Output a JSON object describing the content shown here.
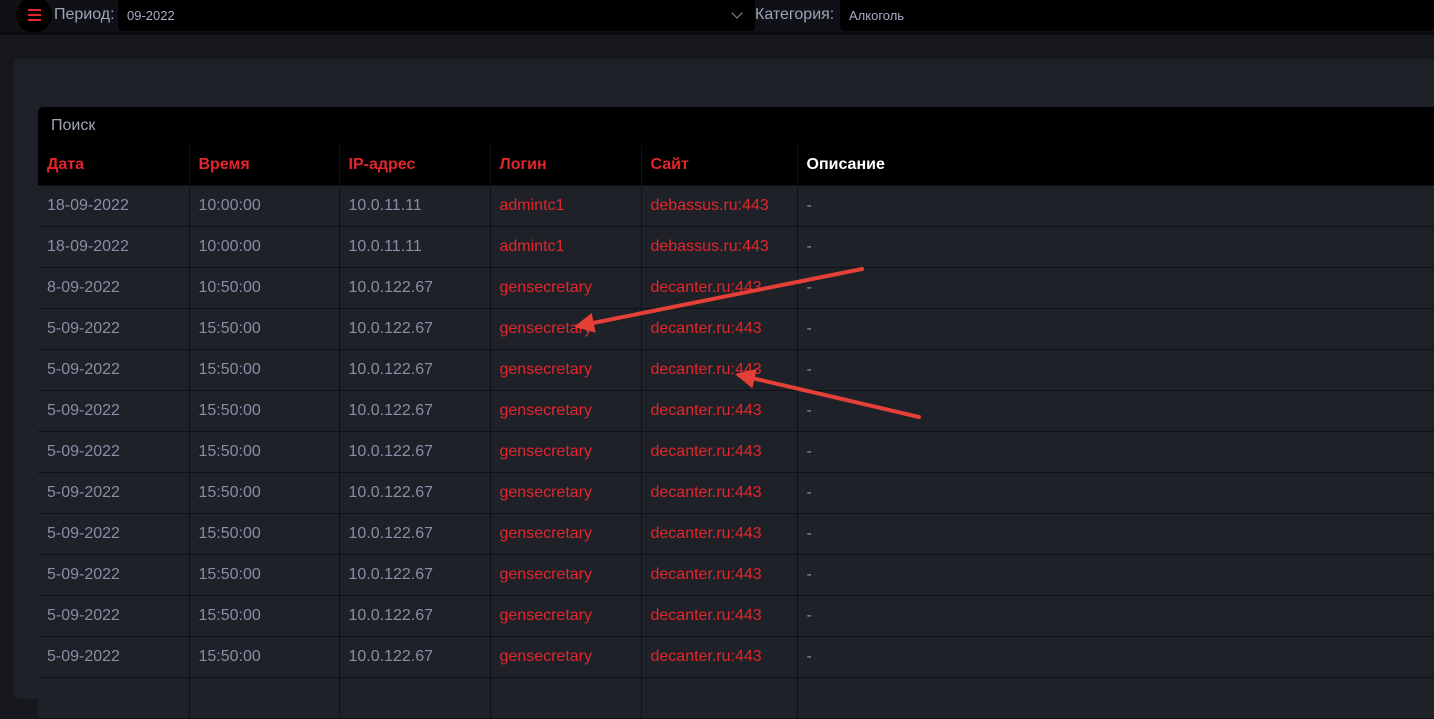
{
  "topbar": {
    "period_label": "Период:",
    "period_value": "09-2022",
    "category_label": "Категория:",
    "category_value": "Алкоголь"
  },
  "search": {
    "placeholder": "Поиск"
  },
  "table": {
    "headers": [
      "Дата",
      "Время",
      "IP-адрес",
      "Логин",
      "Сайт",
      "Описание"
    ],
    "rows": [
      [
        "18-09-2022",
        "10:00:00",
        "10.0.11.11",
        "admintc1",
        "debassus.ru:443",
        "-"
      ],
      [
        "18-09-2022",
        "10:00:00",
        "10.0.11.11",
        "admintc1",
        "debassus.ru:443",
        "-"
      ],
      [
        "8-09-2022",
        "10:50:00",
        "10.0.122.67",
        "gensecretary",
        "decanter.ru:443",
        "-"
      ],
      [
        "5-09-2022",
        "15:50:00",
        "10.0.122.67",
        "gensecretary",
        "decanter.ru:443",
        "-"
      ],
      [
        "5-09-2022",
        "15:50:00",
        "10.0.122.67",
        "gensecretary",
        "decanter.ru:443",
        "-"
      ],
      [
        "5-09-2022",
        "15:50:00",
        "10.0.122.67",
        "gensecretary",
        "decanter.ru:443",
        "-"
      ],
      [
        "5-09-2022",
        "15:50:00",
        "10.0.122.67",
        "gensecretary",
        "decanter.ru:443",
        "-"
      ],
      [
        "5-09-2022",
        "15:50:00",
        "10.0.122.67",
        "gensecretary",
        "decanter.ru:443",
        "-"
      ],
      [
        "5-09-2022",
        "15:50:00",
        "10.0.122.67",
        "gensecretary",
        "decanter.ru:443",
        "-"
      ],
      [
        "5-09-2022",
        "15:50:00",
        "10.0.122.67",
        "gensecretary",
        "decanter.ru:443",
        "-"
      ],
      [
        "5-09-2022",
        "15:50:00",
        "10.0.122.67",
        "gensecretary",
        "decanter.ru:443",
        "-"
      ],
      [
        "5-09-2022",
        "15:50:00",
        "10.0.122.67",
        "gensecretary",
        "decanter.ru:443",
        "-"
      ],
      [
        "",
        "",
        "",
        "",
        "",
        ""
      ]
    ]
  },
  "colors": {
    "accent": "#e3262c",
    "background": "#17181d",
    "panel": "#1f2129",
    "text_muted": "#878ea5"
  },
  "icons": {
    "menu": "hamburger-menu-icon",
    "dropdown": "chevron-down-icon"
  }
}
